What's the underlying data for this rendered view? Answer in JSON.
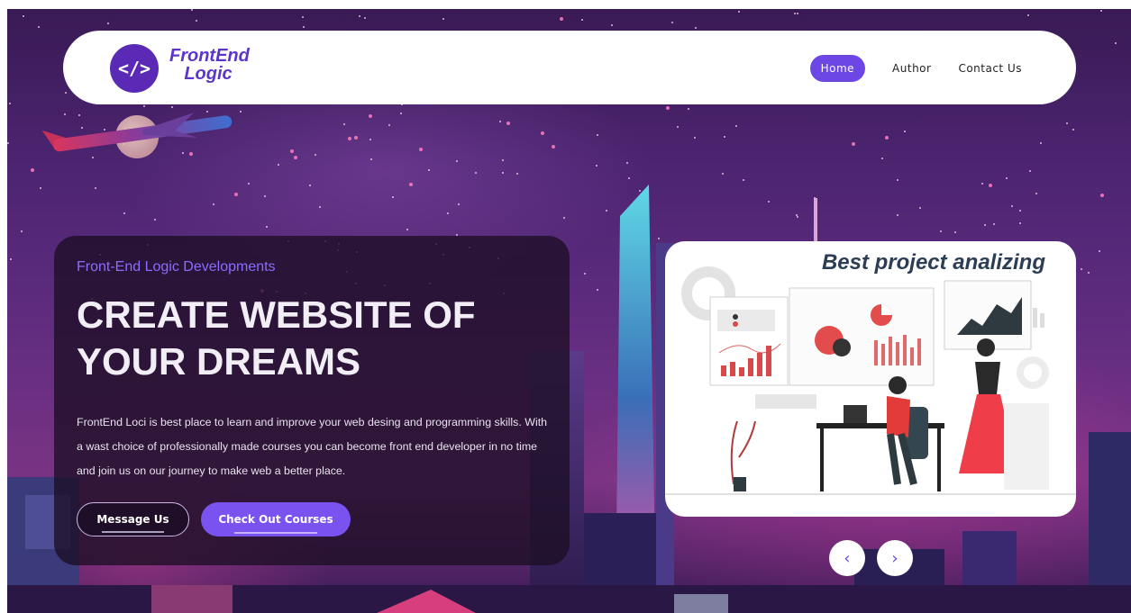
{
  "brand": {
    "logo_symbol": "</>",
    "name_line1": "FrontEnd",
    "name_line2": "Logic"
  },
  "nav": {
    "items": [
      {
        "label": "Home",
        "active": true
      },
      {
        "label": "Author",
        "active": false
      },
      {
        "label": "Contact Us",
        "active": false
      }
    ]
  },
  "hero": {
    "subtitle": "Front-End Logic Developments",
    "title_line1": "CREATE WEBSITE OF",
    "title_line2": "YOUR DREAMS",
    "description": "FrontEnd Loci is best place to learn and improve your web desing and programming skills. With a wast choice of professionally made courses you can become front end developer in no time and join us on our journey to make web a better place.",
    "message_button": "Message Us",
    "courses_button": "Check Out Courses"
  },
  "illustration": {
    "title": "Best project analizing"
  },
  "slider": {
    "prev_icon": "chevron-left-icon",
    "next_icon": "chevron-right-icon",
    "prev_glyph": "‹",
    "next_glyph": "›"
  },
  "colors": {
    "accent": "#6c47e6",
    "brand_purple": "#5a2ab7",
    "subtitle": "#8a6cff"
  }
}
